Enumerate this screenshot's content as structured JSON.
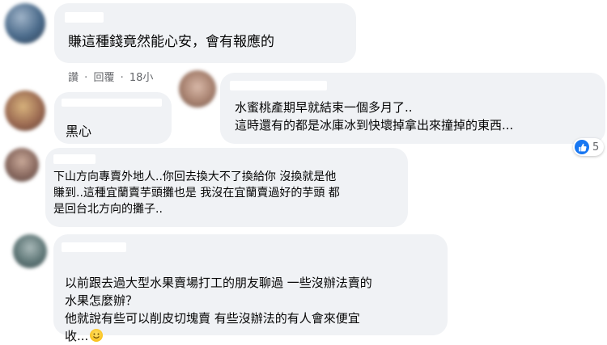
{
  "comments": [
    {
      "text": "賺這種錢竟然能心安，會有報應的"
    },
    {
      "text": "水蜜桃產期早就結束一個多月了..\n這時還有的都是冰庫冰到快壞掉拿出來撞掉的東西..."
    },
    {
      "text": "黑心"
    },
    {
      "text": "下山方向專賣外地人..你回去換大不了換給你 沒換就是他\n賺到..這種宜蘭賣芋頭攤也是 我沒在宜蘭賣過好的芋頭 都\n是回台北方向的攤子.."
    },
    {
      "text": "以前跟去過大型水果賣場打工的朋友聊過 一些沒辦法賣的\n水果怎麼辦？\n他就說有些可以削皮切塊賣 有些沒辦法的有人會來便宜\n收..."
    }
  ],
  "actions": {
    "like": "讚",
    "separator": "·",
    "reply": "回覆",
    "time": "18小"
  },
  "reaction": {
    "count": "5",
    "icon": "like-icon",
    "color": "#1877f2"
  },
  "emoji": {
    "icon": "smile-emoji-icon"
  },
  "colors": {
    "bubble": "#f0f2f5",
    "meta": "#65676b",
    "text": "#050505"
  }
}
